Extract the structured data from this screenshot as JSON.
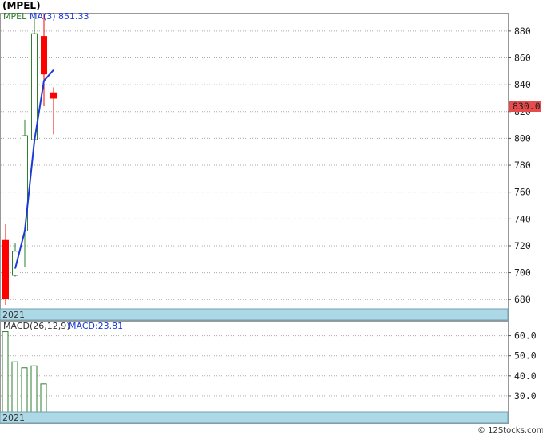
{
  "title": "(MPEL)",
  "credit": "© 12Stocks.com",
  "colors": {
    "up": "#2f7f2f",
    "down": "#ff0000",
    "ma": "#1a3ad6",
    "band": "#add8e6",
    "grid": "#aaaaaa",
    "price_box": "#e84b4b"
  },
  "price_panel": {
    "legend_symbol": "MPEL",
    "legend_ma": "MA(3)",
    "legend_ma_value": "851.33",
    "last_price": "830.0",
    "year_label": "2021"
  },
  "macd_panel": {
    "legend": "MACD(26,12,9)",
    "legend_value": "MACD:23.81",
    "year_label": "2021"
  },
  "chart_data": [
    {
      "type": "candlestick",
      "title": "",
      "ylim": [
        673,
        893
      ],
      "yticks": [
        680,
        700,
        720,
        740,
        760,
        780,
        800,
        820,
        840,
        860,
        880
      ],
      "grid": true,
      "candles": [
        {
          "open": 724,
          "high": 736,
          "low": 676,
          "close": 681
        },
        {
          "open": 698,
          "high": 722,
          "low": 697,
          "close": 716
        },
        {
          "open": 731,
          "high": 814,
          "low": 704,
          "close": 802
        },
        {
          "open": 799,
          "high": 894,
          "low": 797,
          "close": 878
        },
        {
          "open": 876,
          "high": 893,
          "low": 824,
          "close": 848
        },
        {
          "open": 834,
          "high": 838,
          "low": 803,
          "close": 830
        }
      ],
      "ma": {
        "name": "MA(3)",
        "values": [
          null,
          703,
          731,
          798,
          843,
          851
        ]
      }
    },
    {
      "type": "bar",
      "title": "",
      "ylim": [
        22,
        67
      ],
      "yticks": [
        30.0,
        40.0,
        50.0,
        60.0
      ],
      "grid": true,
      "values": [
        62,
        47,
        44,
        45,
        36
      ]
    }
  ]
}
